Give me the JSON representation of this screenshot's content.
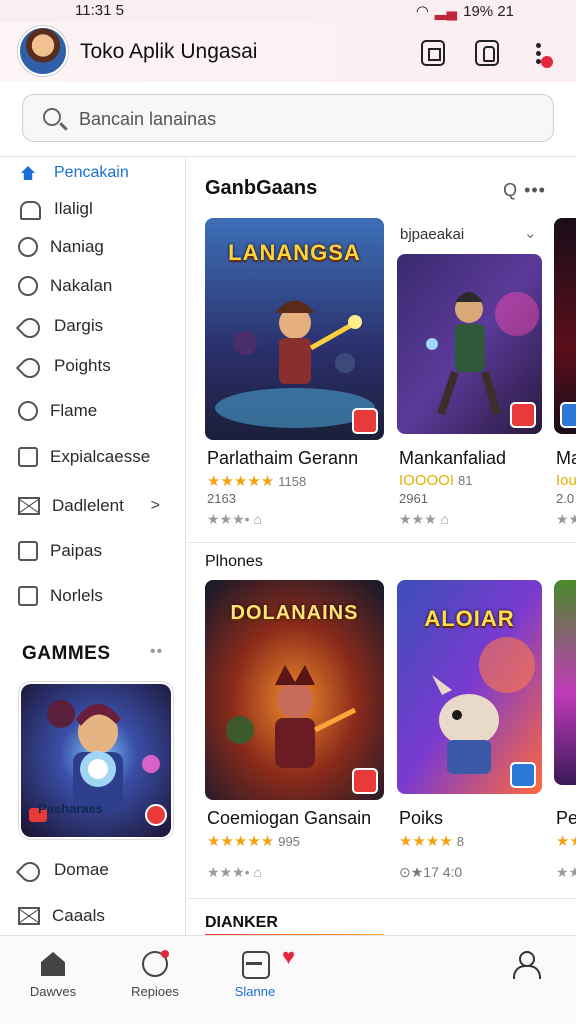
{
  "status_bar": {
    "time": "11:31 5",
    "battery": "19% 21"
  },
  "app": {
    "title": "Toko Aplik Ungasai"
  },
  "search": {
    "placeholder": "Bancain lanainas"
  },
  "sidebar": {
    "items": [
      {
        "label": "Pencakain",
        "icon": "home-icon",
        "active": true
      },
      {
        "label": "Ilaligl",
        "icon": "bell-icon"
      },
      {
        "label": "Naniag",
        "icon": "refresh-icon"
      },
      {
        "label": "Nakalan",
        "icon": "clock-icon"
      },
      {
        "label": "Dargis",
        "icon": "tools-icon"
      },
      {
        "label": "Poights",
        "icon": "pin-icon"
      },
      {
        "label": "Flame",
        "icon": "shield-icon"
      },
      {
        "label": "Expialcaesse",
        "icon": "image-icon"
      },
      {
        "label": "Dadlelent",
        "icon": "mail-icon",
        "chevron": ">"
      },
      {
        "label": "Paipas",
        "icon": "calendar-icon"
      },
      {
        "label": "Norlels",
        "icon": "photo-icon"
      }
    ],
    "games_heading": "GAMMES",
    "games_dots": "••",
    "feature_label": "Paeharaes",
    "bottom_items": [
      {
        "label": "Domae",
        "icon": "wrench-icon"
      },
      {
        "label": "Caaals",
        "icon": "envelope-icon"
      }
    ]
  },
  "sections": [
    {
      "title": "GanbGaans",
      "subtitle": "bjpaeakai",
      "actions": "Q •••",
      "cards": [
        {
          "art_text": "LANANGSA",
          "title": "Parlathaim Gerann",
          "stars": "★★★★★",
          "rating_count": "1158",
          "meta": "2163",
          "minor": "★★★• ⌂"
        },
        {
          "art_text": "",
          "title": "Mankanfaliad",
          "stars": "IOOOOI",
          "rating_count": "81",
          "meta": "2961",
          "minor": "★★★ ⌂"
        },
        {
          "art_text": "",
          "title": "Ma",
          "stars": "Iou",
          "rating_count": "",
          "meta": "2.0",
          "minor": "★★"
        }
      ]
    },
    {
      "title": "Plhones",
      "cards": [
        {
          "art_text": "DOLANAINS",
          "title": "Coemiogan Gansain",
          "stars": "★★★★★",
          "rating_count": "995",
          "meta": "",
          "minor": "★★★• ⌂"
        },
        {
          "art_text": "ALOIAR",
          "title": "Poiks",
          "stars": "★★★★",
          "rating_count": "8",
          "meta": "",
          "minor": "⊙★17 4:0"
        },
        {
          "art_text": "",
          "title": "Pe",
          "stars": "★★",
          "rating_count": "",
          "meta": "",
          "minor": "★★"
        }
      ]
    },
    {
      "title": "DIANKER"
    }
  ],
  "bottom_nav": [
    {
      "label": "Dawves",
      "icon": "house-icon"
    },
    {
      "label": "Repioes",
      "icon": "chat-icon"
    },
    {
      "label": "Slanne",
      "icon": "bag-icon",
      "active": true
    },
    {
      "label": "",
      "icon": "person-icon"
    }
  ],
  "colors": {
    "accent": "#1a6fd6",
    "star": "#f4a116",
    "badge_red": "#e83a3a"
  }
}
